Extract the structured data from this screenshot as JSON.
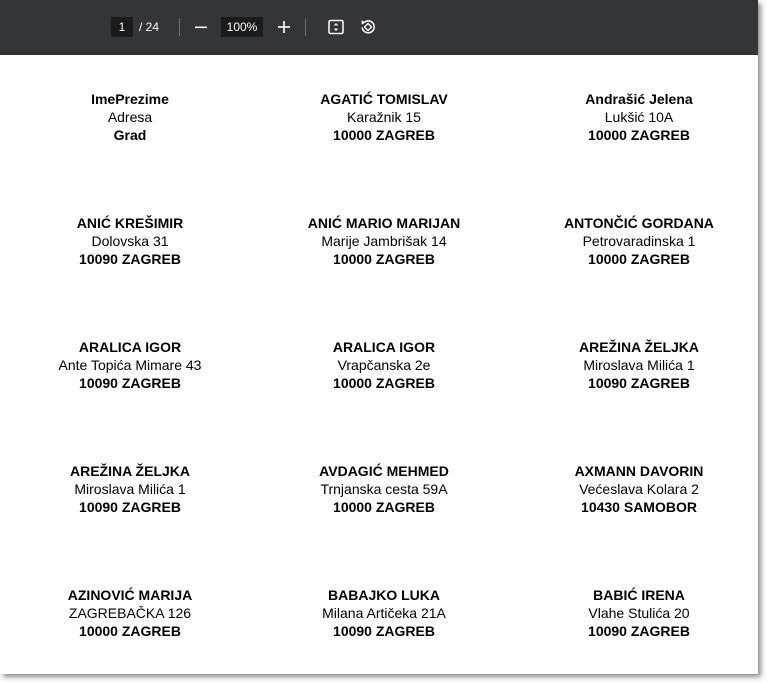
{
  "toolbar": {
    "current_page": "1",
    "page_total": "/ 24",
    "zoom": "100%",
    "icons": [
      "zoom-out-icon",
      "zoom-in-icon",
      "fit-page-icon",
      "rotate-icon"
    ]
  },
  "labels": [
    {
      "name": "ImePrezime",
      "street": "Adresa",
      "city": "Grad"
    },
    {
      "name": "AGATIĆ TOMISLAV",
      "street": "Karažnik 15",
      "city": "10000 ZAGREB"
    },
    {
      "name": "Andrašić Jelena",
      "street": "Lukšić 10A",
      "city": "10000 ZAGREB"
    },
    {
      "name": "ANIĆ KREŠIMIR",
      "street": "Dolovska 31",
      "city": "10090 ZAGREB"
    },
    {
      "name": "ANIĆ MARIO MARIJAN",
      "street": "Marije Jambrišak 14",
      "city": "10000 ZAGREB"
    },
    {
      "name": "ANTONČIĆ GORDANA",
      "street": "Petrovaradinska 1",
      "city": "10000 ZAGREB"
    },
    {
      "name": "ARALICA IGOR",
      "street": "Ante Topića Mimare 43",
      "city": "10090 ZAGREB"
    },
    {
      "name": "ARALICA IGOR",
      "street": "Vrapčanska 2e",
      "city": "10000 ZAGREB"
    },
    {
      "name": "AREŽINA ŽELJKA",
      "street": "Miroslava Milića 1",
      "city": "10090 ZAGREB"
    },
    {
      "name": "AREŽINA ŽELJKA",
      "street": "Miroslava Milića 1",
      "city": "10090 ZAGREB"
    },
    {
      "name": "AVDAGIĆ MEHMED",
      "street": "Trnjanska cesta 59A",
      "city": "10000 ZAGREB"
    },
    {
      "name": "AXMANN DAVORIN",
      "street": "Većeslava Kolara 2",
      "city": "10430 SAMOBOR"
    },
    {
      "name": "AZINOVIĆ MARIJA",
      "street": "ZAGREBAČKA 126",
      "city": "10000 ZAGREB"
    },
    {
      "name": "BABAJKO LUKA",
      "street": "Milana Artičeka 21A",
      "city": "10090 ZAGREB"
    },
    {
      "name": "BABIĆ IRENA",
      "street": "Vlahe Stulića 20",
      "city": "10090 ZAGREB"
    }
  ]
}
